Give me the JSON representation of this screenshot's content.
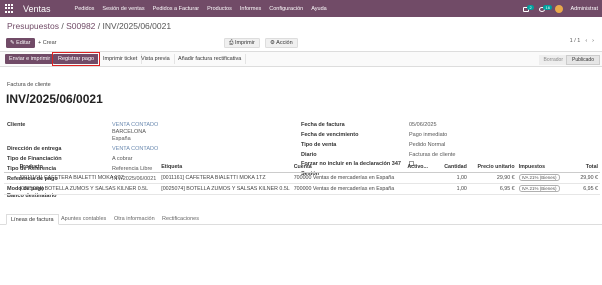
{
  "navbar": {
    "app_name": "Ventas",
    "menus": [
      "Pedidos",
      "Sesión de ventas",
      "Pedidos a Facturar",
      "Productos",
      "Informes",
      "Configuración",
      "Ayuda"
    ],
    "messages_count": "2",
    "activities_count": "16",
    "user": "Administrat"
  },
  "breadcrumb": {
    "parent": "Presupuestos",
    "order": "S00982",
    "current": "INV/2025/06/0021"
  },
  "toolbar": {
    "edit": "Editar",
    "create": "Crear",
    "print": "Imprimir",
    "action": "Acción",
    "pager": "1 / 1"
  },
  "actions": {
    "send_print": "Enviar e imprimir",
    "register_payment": "Registrar pago",
    "print_ticket": "Imprimir ticket",
    "preview": "Vista previa",
    "add_rectifying": "Añadir factura rectificativa",
    "status_draft": "Borrador",
    "status_posted": "Publicado"
  },
  "document": {
    "type": "Factura de cliente",
    "name": "INV/2025/06/0021"
  },
  "left_fields": [
    {
      "label": "Cliente",
      "value": [
        "VENTA CONTADO",
        "BARCELONA",
        "España"
      ]
    },
    {
      "label": "Dirección de entrega",
      "value": "VENTA CONTADO"
    },
    {
      "label": "Tipo de Financiación",
      "value": "A cobrar"
    },
    {
      "label": "Tipo de Referencia",
      "value": "Referencia Libre"
    },
    {
      "label": "Referencia de pago",
      "value": "INV/2025/06/0021"
    },
    {
      "label": "Modo de pago",
      "value": ""
    },
    {
      "label": "Banco destinatario",
      "value": ""
    }
  ],
  "right_fields": [
    {
      "label": "Fecha de factura",
      "value": "05/06/2025"
    },
    {
      "label": "Fecha de vencimiento",
      "value": "Pago inmediato"
    },
    {
      "label": "Tipo de venta",
      "value": "Pedido Normal"
    },
    {
      "label": "Diario",
      "value": "Facturas de cliente"
    },
    {
      "label": "Forzar no incluir en la declaración 347",
      "value": ""
    },
    {
      "label": "Sesión",
      "value": ""
    }
  ],
  "tabs": [
    "Líneas de factura",
    "Apuntes contables",
    "Otra información",
    "Rectificaciones"
  ],
  "table": {
    "headers": [
      "Producto",
      "Etiqueta",
      "Cuenta",
      "Activo...",
      "Cantidad",
      "Precio unitario",
      "Impuestos",
      "Total"
    ],
    "rows": [
      [
        "[0011161] CAFETERA BIALETTI MOKA 1TZ",
        "[0011161] CAFETERA BIALETTI MOKA 1TZ",
        "700000 Ventas de mercaderías en España",
        "",
        "1,00",
        "29,90 €",
        "IVA 21% (Bienes)",
        "29,90 €"
      ],
      [
        "[0025074] BOTELLA ZUMOS Y SALSAS KILNER 0.5L",
        "[0025074] BOTELLA ZUMOS Y SALSAS KILNER 0.5L",
        "700000 Ventas de mercaderías en España",
        "",
        "1,00",
        "6,95 €",
        "IVA 21% (Bienes)",
        "6,95 €"
      ]
    ]
  }
}
